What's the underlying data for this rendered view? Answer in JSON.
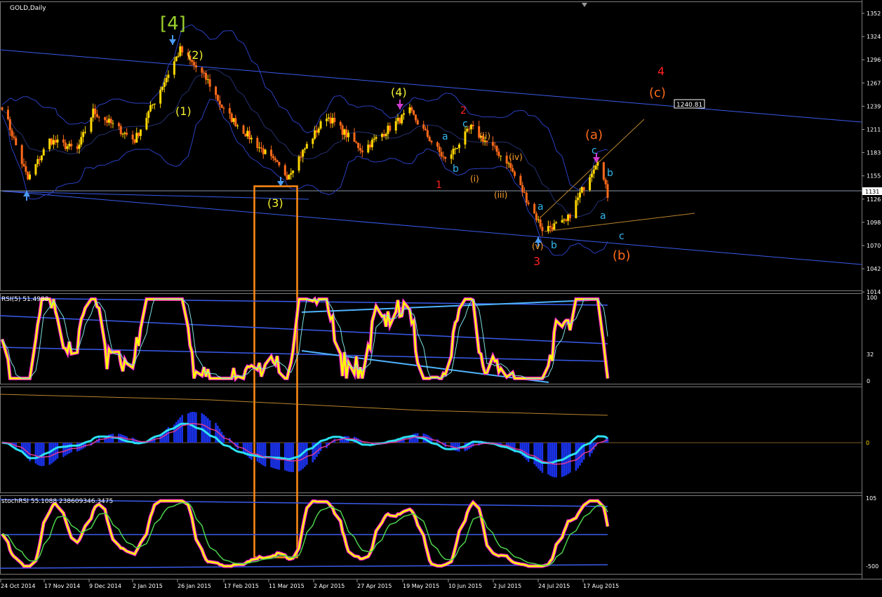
{
  "window": {
    "symbol_label": "GOLD,Daily"
  },
  "colors": {
    "background": "#000000",
    "candle_up": "#FFD700",
    "candle_down": "#FF6A1A",
    "channel_line": "#3A5BEA",
    "bollinger": "#2B3FBF",
    "rsi_main": "#FFFF00",
    "rsi_pink": "#FF2BD6",
    "macd_cyan": "#2CE0F2",
    "histogram": "#1A32E8",
    "highlight_box": "#FF8A14",
    "wave_yellow": "#F4F032",
    "wave_green": "#9BD02C",
    "wave_red": "#FF2020",
    "wave_orange": "#FF6A1A",
    "wave_cyan": "#33B8F0",
    "wave_lightorange": "#FFA030"
  },
  "price_panel": {
    "price_axis_ticks": [
      "1352",
      "1324",
      "1296",
      "1267",
      "1239",
      "1211",
      "1183",
      "1155",
      "1126",
      "1098",
      "1070",
      "1042",
      "1014"
    ],
    "current_price_label": "1131",
    "line_price_label": "1240.81"
  },
  "rsi_panel": {
    "label": "RSI(5) 51.4988",
    "ticks": [
      "100",
      "32",
      "0"
    ]
  },
  "macd_panel": {
    "ticks": [
      "0"
    ]
  },
  "stoch_panel": {
    "label": "stochRSI 55.1088 238609346.3475",
    "ticks": [
      "105",
      "-500"
    ]
  },
  "time_axis": [
    "24 Oct 2014",
    "17 Nov 2014",
    "9 Dec 2014",
    "2 Jan 2015",
    "26 Jan 2015",
    "17 Feb 2015",
    "11 Mar 2015",
    "2 Apr 2015",
    "27 Apr 2015",
    "19 May 2015",
    "10 Jun 2015",
    "2 Jul 2015",
    "24 Jul 2015",
    "17 Aug 2015"
  ],
  "wave_labels": [
    {
      "text": "[4]",
      "color": "green"
    },
    {
      "text": "(2)",
      "color": "yellow"
    },
    {
      "text": "(1)",
      "color": "yellow"
    },
    {
      "text": "(3)",
      "color": "yellow"
    },
    {
      "text": "(4)",
      "color": "yellow"
    },
    {
      "text": "2",
      "color": "red"
    },
    {
      "text": "1",
      "color": "red"
    },
    {
      "text": "3",
      "color": "red"
    },
    {
      "text": "4",
      "color": "red"
    },
    {
      "text": "(a)",
      "color": "orange"
    },
    {
      "text": "(c)",
      "color": "orange"
    },
    {
      "text": "(b)",
      "color": "orange"
    },
    {
      "text": "(ii)",
      "color": "lightorange"
    },
    {
      "text": "(i)",
      "color": "lightorange"
    },
    {
      "text": "(iv)",
      "color": "lightorange"
    },
    {
      "text": "(iii)",
      "color": "lightorange"
    },
    {
      "text": "(v)",
      "color": "lightorange"
    },
    {
      "text": "c",
      "color": "cyan"
    },
    {
      "text": "a",
      "color": "cyan"
    },
    {
      "text": "b",
      "color": "cyan"
    },
    {
      "text": "a",
      "color": "cyan"
    },
    {
      "text": "b",
      "color": "cyan"
    },
    {
      "text": "c",
      "color": "cyan"
    },
    {
      "text": "b",
      "color": "cyan"
    },
    {
      "text": "a",
      "color": "cyan"
    },
    {
      "text": "c",
      "color": "cyan"
    }
  ],
  "chart_data": {
    "type": "candlestick",
    "title": "GOLD,Daily",
    "x_start": "24 Oct 2014",
    "x_end": "26 Aug 2015",
    "ylim": [
      1014,
      1352
    ],
    "close_waypoints": [
      {
        "date": "2014-10-24",
        "close": 1232
      },
      {
        "date": "2014-11-06",
        "close": 1142
      },
      {
        "date": "2014-11-17",
        "close": 1190
      },
      {
        "date": "2014-12-01",
        "close": 1178
      },
      {
        "date": "2014-12-09",
        "close": 1225
      },
      {
        "date": "2014-12-30",
        "close": 1190
      },
      {
        "date": "2015-01-22",
        "close": 1300
      },
      {
        "date": "2015-02-05",
        "close": 1262
      },
      {
        "date": "2015-02-13",
        "close": 1226
      },
      {
        "date": "2015-03-17",
        "close": 1147
      },
      {
        "date": "2015-04-06",
        "close": 1220
      },
      {
        "date": "2015-04-24",
        "close": 1178
      },
      {
        "date": "2015-05-18",
        "close": 1225
      },
      {
        "date": "2015-06-05",
        "close": 1165
      },
      {
        "date": "2015-06-18",
        "close": 1205
      },
      {
        "date": "2015-07-06",
        "close": 1165
      },
      {
        "date": "2015-07-24",
        "close": 1082
      },
      {
        "date": "2015-08-05",
        "close": 1090
      },
      {
        "date": "2015-08-21",
        "close": 1168
      },
      {
        "date": "2015-08-26",
        "close": 1123
      }
    ],
    "rsi_range": [
      0,
      100
    ],
    "rsi_levels": [
      100,
      32,
      0
    ],
    "stoch_levels": [
      105,
      -500
    ],
    "grid": false,
    "legend": "none"
  }
}
